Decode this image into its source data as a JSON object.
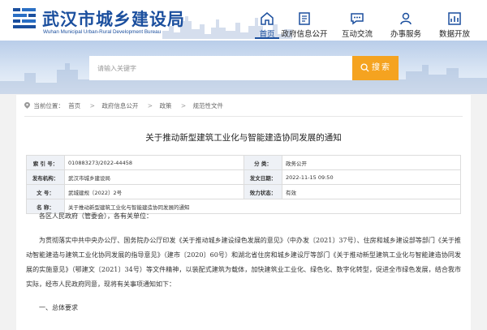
{
  "header": {
    "title": "武汉市城乡建设局",
    "subtitle": "Wuhan Municipal Urban-Rural Development Bureau",
    "nav": [
      {
        "label": "首页",
        "icon": "home-icon",
        "active": true
      },
      {
        "label": "政府信息公开",
        "icon": "document-icon",
        "active": false
      },
      {
        "label": "互动交流",
        "icon": "chat-icon",
        "active": false
      },
      {
        "label": "办事服务",
        "icon": "user-service-icon",
        "active": false
      },
      {
        "label": "数据开放",
        "icon": "data-icon",
        "active": false
      }
    ]
  },
  "colors": {
    "brand": "#1b4f9e",
    "search_button": "#f5a320"
  },
  "search": {
    "placeholder": "请输入关键字",
    "button": "搜索"
  },
  "breadcrumb": {
    "label": "当前位置：",
    "items": [
      "首页",
      "政府信息公开",
      "政策",
      "规范性文件"
    ]
  },
  "document": {
    "title": "关于推动新型建筑工业化与智能建造协同发展的通知",
    "meta": {
      "index_label": "索 引 号：",
      "index_value": "010883273/2022-44458",
      "category_label": "分 类：",
      "category_value": "政务公开",
      "publisher_label": "发布机构：",
      "publisher_value": "武汉市城乡建设局",
      "date_label": "发文日期：",
      "date_value": "2022-11-15 09:50",
      "number_label": "文 号：",
      "number_value": "武城建规〔2022〕2号",
      "status_label": "效力状态：",
      "status_value": "有效",
      "name_label": "名 称：",
      "name_value": "关于推动新型建筑工业化与智能建造协同发展的通知"
    },
    "salutation": "各区人民政府（管委会），各有关单位：",
    "paragraph": "为贯彻落实中共中央办公厅、国务院办公厅印发《关于推动城乡建设绿色发展的意见》（中办发〔2021〕37号）、住房和城乡建设部等部门《关于推动智能建造与建筑工业化协同发展的指导意见》（建市〔2020〕60号）和湖北省住房和城乡建设厅等部门《关于推动新型建筑工业化与智能建造协同发展的实施意见》（鄂建文〔2021〕34号）等文件精神，以装配式建筑为载体，加快建筑业工业化、绿色化、数字化转型，促进全市绿色发展，结合我市实际，经市人民政府同意，现将有关事项通知如下：",
    "section1": "一、总体要求"
  }
}
